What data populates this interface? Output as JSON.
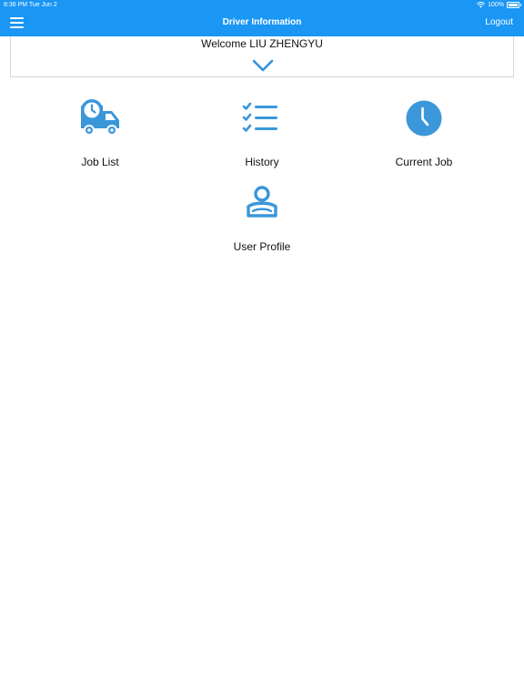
{
  "status_bar": {
    "time": "8:36 PM   Tue Jun 2",
    "battery": "100%"
  },
  "nav": {
    "title": "Driver Information",
    "logout_label": "Logout"
  },
  "welcome": {
    "text": "Welcome LIU ZHENGYU"
  },
  "menu": [
    {
      "label": "Job List",
      "icon": "truck-clock-icon"
    },
    {
      "label": "History",
      "icon": "checklist-icon"
    },
    {
      "label": "Current Job",
      "icon": "clock-icon"
    },
    {
      "label": "User Profile",
      "icon": "user-icon"
    }
  ],
  "colors": {
    "accent": "#1a96f5",
    "icon": "#3a97da"
  }
}
